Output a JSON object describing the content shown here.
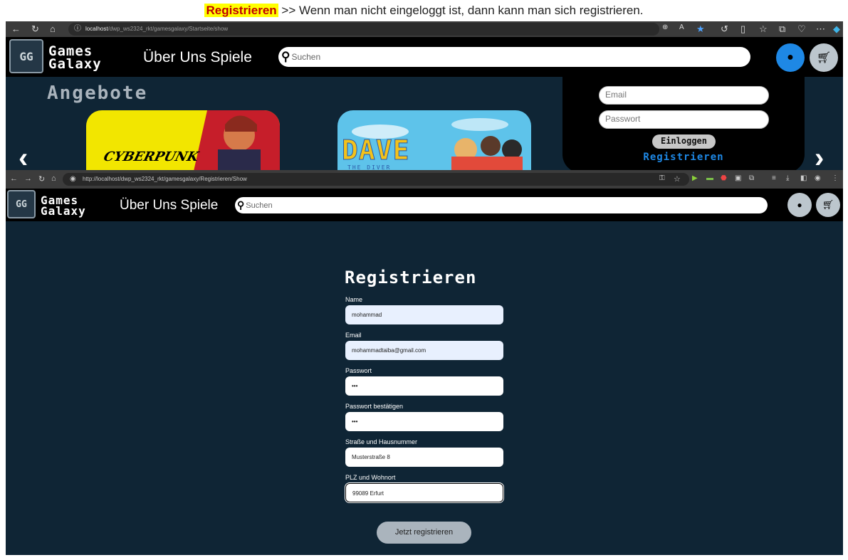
{
  "caption": {
    "highlight": "Registrieren",
    "text": " >> Wenn man nicht eingeloggt ist, dann kann man sich registrieren."
  },
  "browser1": {
    "url_host": "localhost",
    "url_path": "/dwp_ws2324_rkt/gamesgalaxy/Startseite/show",
    "logo_text": "GG",
    "brand_line1": "Games",
    "brand_line2": "Galaxy",
    "nav": "Über Uns Spiele",
    "search_placeholder": "Suchen",
    "angebote": "Angebote",
    "card1_text": "CYBERPUNK",
    "card2_text": "DAVE",
    "card2_sub": "THE DIVER",
    "login": {
      "email_placeholder": "Email",
      "password_placeholder": "Passwort",
      "login_button": "Einloggen",
      "register_link": "Registrieren"
    },
    "accent_color": "#1e88e5"
  },
  "browser2": {
    "url": "http://localhost/dwp_ws2324_rkt/gamesgalaxy/Registrieren/Show",
    "logo_text": "GG",
    "brand_line1": "Games",
    "brand_line2": "Galaxy",
    "nav": "Über Uns Spiele",
    "search_placeholder": "Suchen",
    "form": {
      "title": "Registrieren",
      "fields": [
        {
          "label": "Name",
          "value": "mohammad"
        },
        {
          "label": "Email",
          "value": "mohammadtaiba@gmail.com"
        },
        {
          "label": "Passwort",
          "value": "•••"
        },
        {
          "label": "Passwort bestätigen",
          "value": "•••"
        },
        {
          "label": "Straße und Hausnummer",
          "value": "Musterstraße 8"
        },
        {
          "label": "PLZ und Wohnort",
          "value": "99089 Erfurt"
        }
      ],
      "submit": "Jetzt registrieren"
    }
  }
}
